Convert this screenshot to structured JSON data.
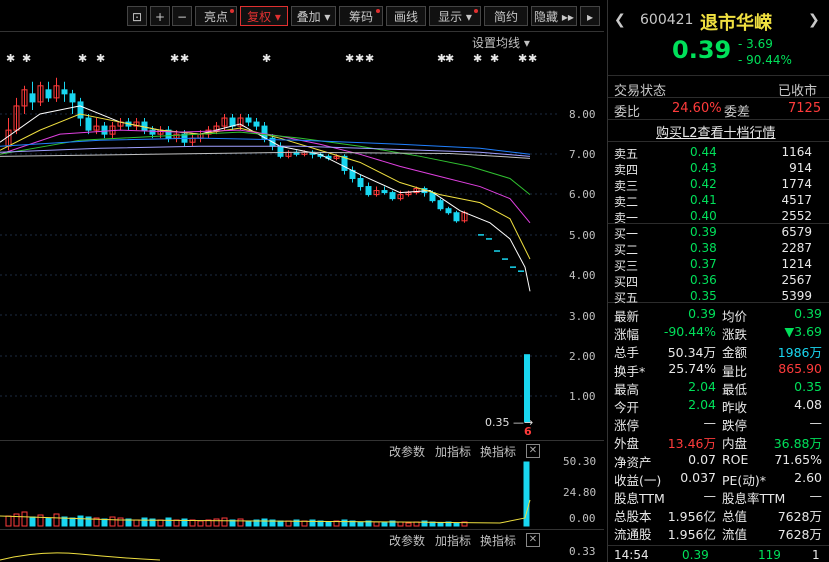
{
  "toolbar": {
    "items": [
      "亮点",
      "复权",
      "叠加",
      "筹码",
      "画线",
      "显示",
      "简约",
      "隐藏"
    ],
    "active": "复权"
  },
  "chart": {
    "ma_settings": "设置均线",
    "price_axis": [
      "8.00",
      "7.00",
      "6.00",
      "5.00",
      "4.00",
      "3.00",
      "2.00",
      "1.00"
    ],
    "low_marker": "0.35",
    "low_marker_badge": "6",
    "colors": {
      "up": "#ff3b3b",
      "down": "#19d6f0",
      "ma5": "#ffffff",
      "ma10": "#f0e040",
      "ma20": "#e040e0",
      "ma30": "#30c030",
      "ma60": "#2080ff"
    }
  },
  "volume_panel": {
    "buttons": [
      "改参数",
      "加指标",
      "换指标"
    ],
    "axis": [
      "50.30",
      "24.80",
      "0.00"
    ]
  },
  "sub_panel": {
    "buttons": [
      "改参数",
      "加指标",
      "换指标"
    ],
    "axis": [
      "0.33"
    ]
  },
  "stock": {
    "code": "600421",
    "name": "退市华嵘",
    "price": "0.39",
    "change": "- 3.69",
    "change_pct": "- 90.44%",
    "status_label": "交易状态",
    "status_value": "已收市",
    "weibi_label": "委比",
    "weibi_value": "24.60%",
    "weicha_label": "委差",
    "weicha_value": "7125",
    "l2_link": "购买L2查看十档行情"
  },
  "sell_orders": [
    {
      "label": "卖五",
      "price": "0.44",
      "volume": "1164"
    },
    {
      "label": "卖四",
      "price": "0.43",
      "volume": "914"
    },
    {
      "label": "卖三",
      "price": "0.42",
      "volume": "1774"
    },
    {
      "label": "卖二",
      "price": "0.41",
      "volume": "4517"
    },
    {
      "label": "卖一",
      "price": "0.40",
      "volume": "2552"
    }
  ],
  "buy_orders": [
    {
      "label": "买一",
      "price": "0.39",
      "volume": "6579"
    },
    {
      "label": "买二",
      "price": "0.38",
      "volume": "2287"
    },
    {
      "label": "买三",
      "price": "0.37",
      "volume": "1214"
    },
    {
      "label": "买四",
      "price": "0.36",
      "volume": "2567"
    },
    {
      "label": "买五",
      "price": "0.35",
      "volume": "5399"
    }
  ],
  "stats": [
    {
      "l1": "最新",
      "v1": "0.39",
      "c1": "green",
      "l2": "均价",
      "v2": "0.39",
      "c2": "green"
    },
    {
      "l1": "涨幅",
      "v1": "-90.44%",
      "c1": "green",
      "l2": "涨跌",
      "v2": "▼3.69",
      "c2": "green"
    },
    {
      "l1": "总手",
      "v1": "50.34万",
      "c1": "white",
      "l2": "金额",
      "v2": "1986万",
      "c2": "cyan"
    },
    {
      "l1": "换手*",
      "v1": "25.74%",
      "c1": "white",
      "l2": "量比",
      "v2": "865.90",
      "c2": "red"
    },
    {
      "l1": "最高",
      "v1": "2.04",
      "c1": "green",
      "l2": "最低",
      "v2": "0.35",
      "c2": "green"
    },
    {
      "l1": "今开",
      "v1": "2.04",
      "c1": "green",
      "l2": "昨收",
      "v2": "4.08",
      "c2": "white"
    },
    {
      "l1": "涨停",
      "v1": "—",
      "c1": "white",
      "l2": "跌停",
      "v2": "—",
      "c2": "white"
    },
    {
      "l1": "外盘",
      "v1": "13.46万",
      "c1": "red",
      "l2": "内盘",
      "v2": "36.88万",
      "c2": "green"
    },
    {
      "l1": "净资产",
      "v1": "0.07",
      "c1": "white",
      "l2": "ROE",
      "v2": "71.65%",
      "c2": "white"
    },
    {
      "l1": "收益(一)",
      "v1": "0.037",
      "c1": "white",
      "l2": "PE(动)*",
      "v2": "2.60",
      "c2": "white"
    },
    {
      "l1": "股息TTM",
      "v1": "—",
      "c1": "white",
      "l2": "股息率TTM",
      "v2": "—",
      "c2": "white"
    },
    {
      "l1": "总股本",
      "v1": "1.956亿",
      "c1": "white",
      "l2": "总值",
      "v2": "7628万",
      "c2": "white"
    },
    {
      "l1": "流通股",
      "v1": "1.956亿",
      "c1": "white",
      "l2": "流值",
      "v2": "7628万",
      "c2": "white"
    }
  ],
  "tick": {
    "time": "14:54",
    "price": "0.39",
    "volume": "119",
    "num": "1"
  }
}
